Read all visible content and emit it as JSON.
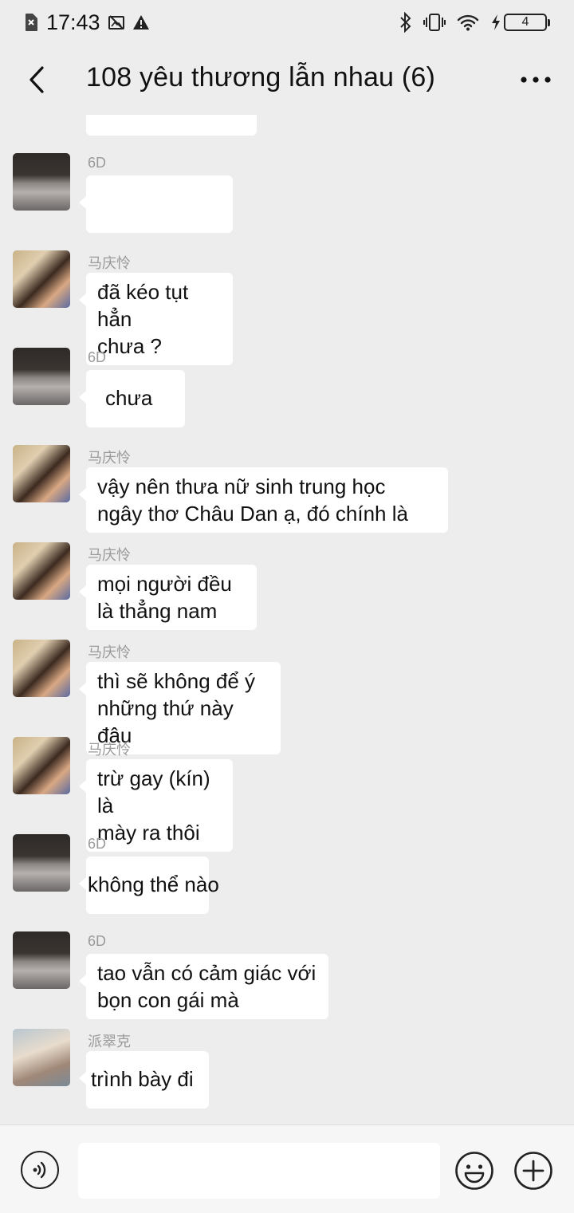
{
  "status_bar": {
    "time": "17:43",
    "battery": "4"
  },
  "header": {
    "title": "108 yêu thương lẫn nhau (6)"
  },
  "messages": [
    {
      "sender": "6D",
      "avatar": "avatar-6d",
      "lines": [
        "",
        ""
      ]
    },
    {
      "sender": "马庆怜",
      "avatar": "avatar-ma",
      "lines": [
        "đã kéo tụt hẳn",
        "chưa ?"
      ]
    },
    {
      "sender": "6D",
      "avatar": "avatar-6d",
      "lines": [
        "chưa"
      ]
    },
    {
      "sender": "马庆怜",
      "avatar": "avatar-ma",
      "lines": [
        "vậy nên thưa nữ sinh trung học",
        "ngây thơ Châu Dan ạ, đó chính là"
      ]
    },
    {
      "sender": "马庆怜",
      "avatar": "avatar-ma",
      "lines": [
        "mọi người đều",
        "là thẳng nam"
      ]
    },
    {
      "sender": "马庆怜",
      "avatar": "avatar-ma",
      "lines": [
        "thì sẽ không để ý",
        "những thứ này đâu"
      ]
    },
    {
      "sender": "马庆怜",
      "avatar": "avatar-ma",
      "lines": [
        "trừ gay (kín) là",
        "mày ra thôi"
      ]
    },
    {
      "sender": "6D",
      "avatar": "avatar-6d",
      "lines": [
        "không thể nào"
      ]
    },
    {
      "sender": "6D",
      "avatar": "avatar-6d",
      "lines": [
        "tao vẫn có cảm giác với",
        "bọn con gái mà"
      ]
    },
    {
      "sender": "派翠克",
      "avatar": "avatar-pai",
      "lines": [
        "trình bày đi"
      ]
    }
  ],
  "input": {
    "placeholder": ""
  },
  "icons": {
    "back": "back-arrow-icon",
    "more": "more-icon",
    "voice": "voice-icon",
    "emoji": "emoji-icon",
    "plus": "plus-icon"
  }
}
